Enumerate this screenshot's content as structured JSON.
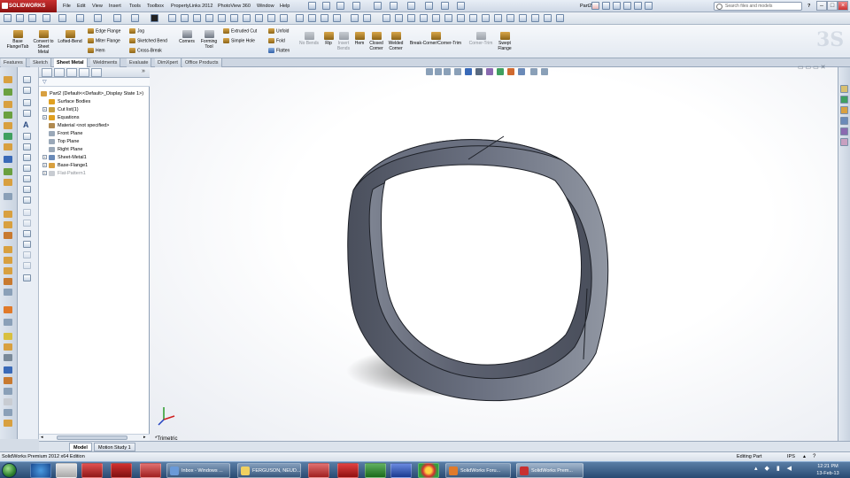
{
  "app": {
    "logo_text": "SOLIDWORKS",
    "document_title": "Part2 *",
    "menu": [
      "File",
      "Edit",
      "View",
      "Insert",
      "Tools",
      "Toolbox",
      "PropertyLinks 2012",
      "PhotoView 360",
      "Window",
      "Help"
    ],
    "search_placeholder": "Search files and models",
    "help_label": "?"
  },
  "ribbon": {
    "big_buttons": [
      {
        "label": "Base Flange/Tab"
      },
      {
        "label": "Convert to Sheet Metal"
      },
      {
        "label": "Lofted-Bend"
      }
    ],
    "small_col1": [
      "Edge Flange",
      "Miter Flange",
      "Hem"
    ],
    "small_col2": [
      "Jog",
      "Sketched Bend",
      "Cross-Break"
    ],
    "corners_label": "Corners",
    "forming_tool_label": "Forming Tool",
    "small_col3": [
      "Extruded Cut",
      "Simple Hole"
    ],
    "small_col4": [
      "Unfold",
      "Fold",
      "Flatten"
    ],
    "no_bends_label": "No Bends",
    "rip_label": "Rip",
    "insert_bends_label": "Insert Bends",
    "hem_label": "Hem",
    "closed_corner_label": "Closed Corner",
    "welded_corner_label": "Welded Corner",
    "break_corner_label": "Break-Corner/Corner-Trim",
    "corner_trim_label": "Corner-Trim",
    "swept_flange_label": "Swept Flange"
  },
  "command_tabs": [
    "Features",
    "Sketch",
    "Sheet Metal",
    "Weldments",
    "Evaluate",
    "DimXpert",
    "Office Products"
  ],
  "active_tab": "Sheet Metal",
  "feature_tree": {
    "root": "Part2  (Default<<Default>_Display State 1>)",
    "nodes": [
      {
        "label": "Surface Bodies",
        "expandable": false,
        "dim": false,
        "color": "#e0a020"
      },
      {
        "label": "Cut list(1)",
        "expandable": true,
        "dim": false,
        "color": "#c8a040"
      },
      {
        "label": "Equations",
        "expandable": true,
        "dim": false,
        "color": "#e0a020"
      },
      {
        "label": "Material <not specified>",
        "expandable": false,
        "dim": false,
        "color": "#b08a50"
      },
      {
        "label": "Front Plane",
        "expandable": false,
        "dim": false,
        "color": "#9aa8b8"
      },
      {
        "label": "Top Plane",
        "expandable": false,
        "dim": false,
        "color": "#9aa8b8"
      },
      {
        "label": "Right Plane",
        "expandable": false,
        "dim": false,
        "color": "#9aa8b8"
      },
      {
        "label": "Sheet-Metal1",
        "expandable": true,
        "dim": false,
        "color": "#6a8ab8"
      },
      {
        "label": "Base-Flange1",
        "expandable": true,
        "dim": false,
        "color": "#d8a040"
      },
      {
        "label": "Flat-Pattern1",
        "expandable": true,
        "dim": true,
        "color": "#c8ccd2"
      }
    ]
  },
  "viewport": {
    "view_name": "*Trimetric",
    "part_color": "#5c6170"
  },
  "bottom_tabs": [
    "Model",
    "Motion Study 1"
  ],
  "status": {
    "left": "SolidWorks Premium 2012 x64 Edition",
    "mode": "Editing Part",
    "units": "IPS"
  },
  "taskbar": {
    "windows": [
      {
        "label": "Inbox - Windows ...",
        "color": "#6a9ad8"
      },
      {
        "label": "FERGUSON, NEUD...",
        "color": "#f0d060"
      },
      {
        "label": "SolidWorks Foru...",
        "color": "#e07a2a"
      },
      {
        "label": "SolidWorks Prem...",
        "color": "#c83030"
      }
    ],
    "time": "12:21 PM",
    "date": "13-Feb-13"
  }
}
